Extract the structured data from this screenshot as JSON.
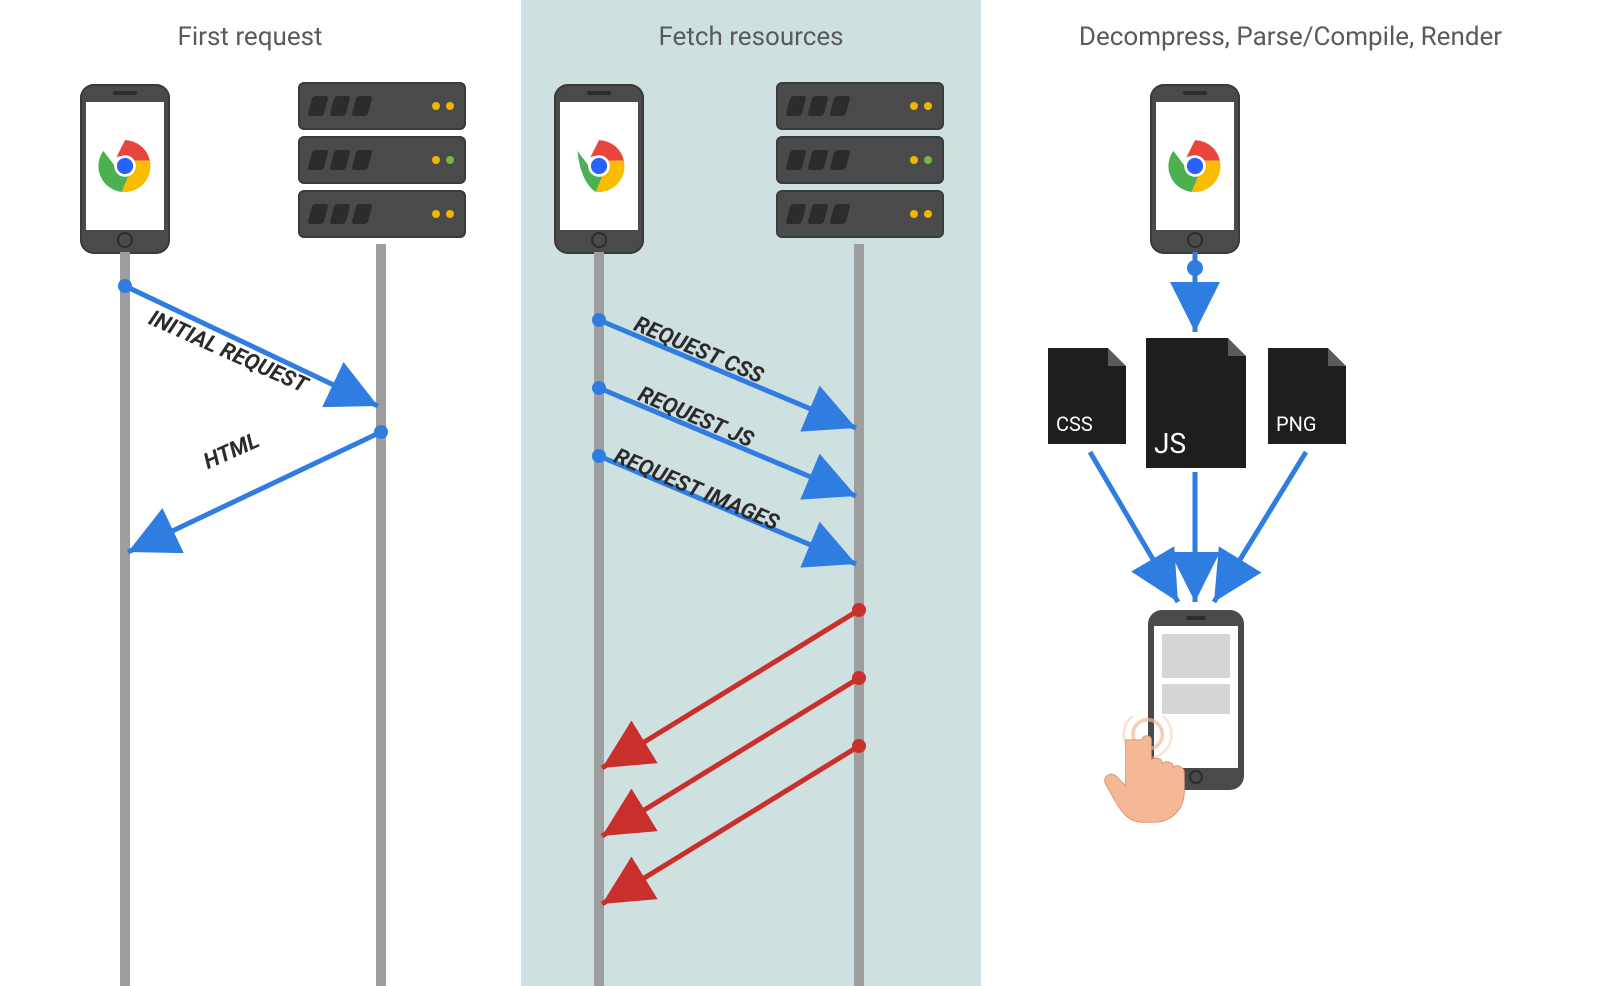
{
  "panels": {
    "first": {
      "title": "First request"
    },
    "fetch": {
      "title": "Fetch resources"
    },
    "render": {
      "title": "Decompress, Parse/Compile, Render"
    }
  },
  "messages": {
    "initial_request": "INITIAL REQUEST",
    "html": "HTML",
    "request_css": "REQUEST CSS",
    "request_js": "REQUEST JS",
    "request_images": "REQUEST IMAGES"
  },
  "files": {
    "css": "CSS",
    "js": "JS",
    "png": "PNG"
  },
  "colors": {
    "request_arrow": "#2f7de1",
    "response_arrow": "#c9302b",
    "lifeline": "#9e9e9e",
    "panel_bg": "#cfe0e1"
  }
}
